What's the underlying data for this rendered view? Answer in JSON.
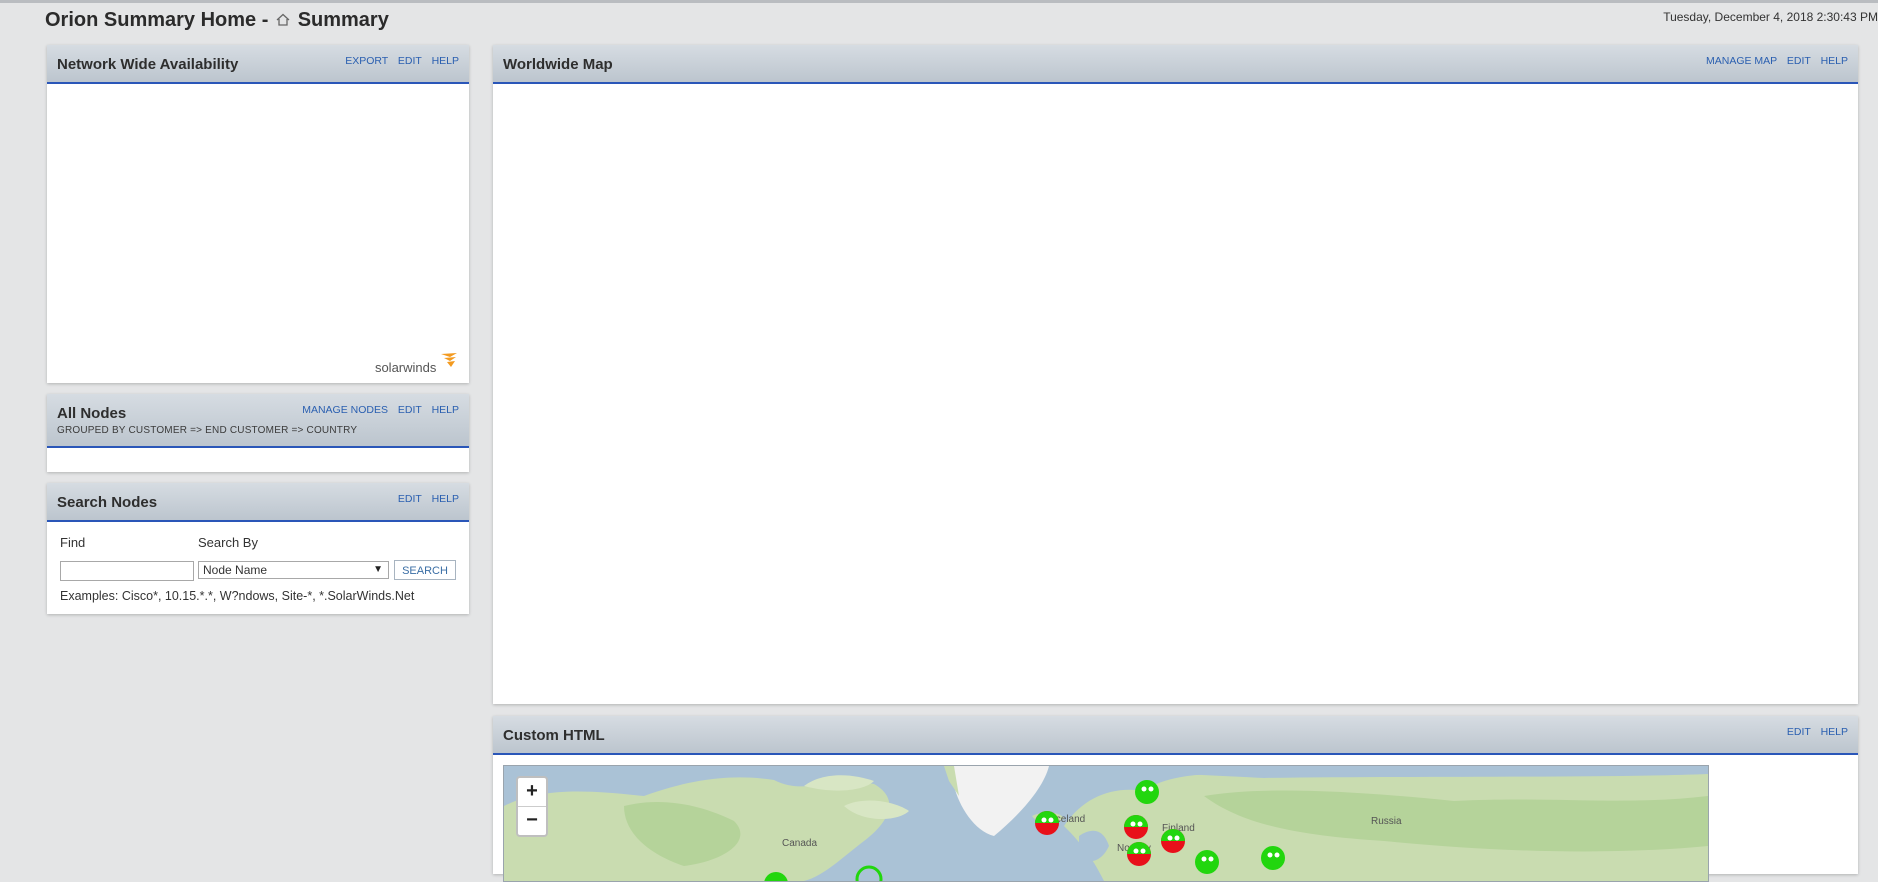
{
  "header": {
    "title_prefix": "Orion Summary Home -",
    "home_icon": "home-icon",
    "title_page": "Summary",
    "datetime": "Tuesday, December 4, 2018 2:30:43 PM"
  },
  "panels": {
    "availability": {
      "title": "Network Wide Availability",
      "links": [
        "EXPORT",
        "EDIT",
        "HELP"
      ],
      "logo_text": "solarwinds"
    },
    "all_nodes": {
      "title": "All Nodes",
      "subtitle": "GROUPED BY CUSTOMER => END CUSTOMER => COUNTRY",
      "links": [
        "MANAGE NODES",
        "EDIT",
        "HELP"
      ]
    },
    "search_nodes": {
      "title": "Search Nodes",
      "links": [
        "EDIT",
        "HELP"
      ],
      "find_label": "Find",
      "find_value": "",
      "search_by_label": "Search By",
      "search_by_selected": "Node Name",
      "search_button": "SEARCH",
      "examples": "Examples: Cisco*, 10.15.*.*, W?ndows, Site-*, *.SolarWinds.Net"
    },
    "worldwide_map": {
      "title": "Worldwide Map",
      "links": [
        "MANAGE MAP",
        "EDIT",
        "HELP"
      ]
    },
    "custom_html": {
      "title": "Custom HTML",
      "links": [
        "EDIT",
        "HELP"
      ],
      "map": {
        "zoom_in": "+",
        "zoom_out": "−",
        "labels": [
          "Canada",
          "Iceland",
          "Norway",
          "Finland",
          "Russia"
        ],
        "status_colors": {
          "up": "#22d60e",
          "down": "#e8101a"
        }
      }
    }
  }
}
